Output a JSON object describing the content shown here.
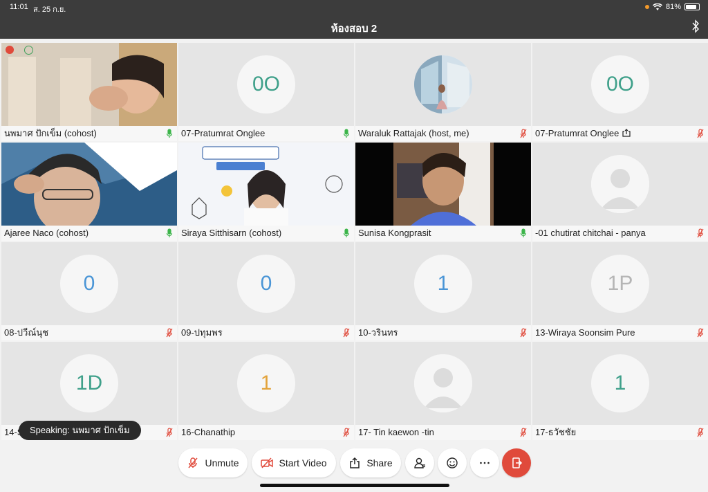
{
  "status": {
    "time": "11:01",
    "date": "ส. 25 ก.ย.",
    "battery": "81%",
    "battery_level": 0.81
  },
  "title": "ห้องสอบ 2",
  "tiles": [
    {
      "name": "นพมาศ ปักเข็ม (cohost)",
      "initials": "",
      "initials_color": "",
      "mic": "on",
      "type": "video1"
    },
    {
      "name": "07-Pratumrat Onglee",
      "initials": "0O",
      "initials_color": "#3fa08a",
      "mic": "on",
      "type": "initials"
    },
    {
      "name": "Waraluk Rattajak (host, me)",
      "initials": "",
      "initials_color": "",
      "mic": "off",
      "type": "photo"
    },
    {
      "name": "07-Pratumrat Onglee",
      "initials": "0O",
      "initials_color": "#3fa08a",
      "mic": "off",
      "type": "initials",
      "share_icon": true
    },
    {
      "name": "Ajaree Naco (cohost)",
      "initials": "",
      "initials_color": "",
      "mic": "on",
      "type": "video2"
    },
    {
      "name": "Siraya Sitthisarn (cohost)",
      "initials": "",
      "initials_color": "",
      "mic": "on",
      "type": "video3"
    },
    {
      "name": "Sunisa Kongprasit",
      "initials": "",
      "initials_color": "",
      "mic": "on",
      "type": "video4"
    },
    {
      "name": "-01 chutirat chitchai - panya",
      "initials": "",
      "initials_color": "",
      "mic": "off",
      "type": "avatar"
    },
    {
      "name": "08-ปวีณ์นุช",
      "initials": "0",
      "initials_color": "#4a95d6",
      "mic": "off",
      "type": "initials"
    },
    {
      "name": "09-ปทุมพร",
      "initials": "0",
      "initials_color": "#4a95d6",
      "mic": "off",
      "type": "initials"
    },
    {
      "name": "10-วรินทร",
      "initials": "1",
      "initials_color": "#4a95d6",
      "mic": "off",
      "type": "initials"
    },
    {
      "name": "13-Wiraya Soonsim Pure",
      "initials": "1P",
      "initials_color": "#b5b5b5",
      "mic": "off",
      "type": "initials"
    },
    {
      "name": "14-So",
      "initials": "1D",
      "initials_color": "#3fa08a",
      "mic": "off",
      "type": "initials"
    },
    {
      "name": "16-Chanathip",
      "initials": "1",
      "initials_color": "#e3a33a",
      "mic": "off",
      "type": "initials"
    },
    {
      "name": "17- Tin kaewon -tin",
      "initials": "",
      "initials_color": "",
      "mic": "off",
      "type": "avatar"
    },
    {
      "name": "17-ธวัชชัย",
      "initials": "1",
      "initials_color": "#3fa08a",
      "mic": "off",
      "type": "initials"
    }
  ],
  "speaking": "Speaking: นพมาศ ปักเข็ม",
  "toolbar": {
    "unmute": "Unmute",
    "start_video": "Start Video",
    "share": "Share"
  },
  "colors": {
    "mic_on": "#3cb54a",
    "mic_off": "#e04a3b",
    "leave": "#e04a3b",
    "active_border": "#3b7dd8"
  }
}
